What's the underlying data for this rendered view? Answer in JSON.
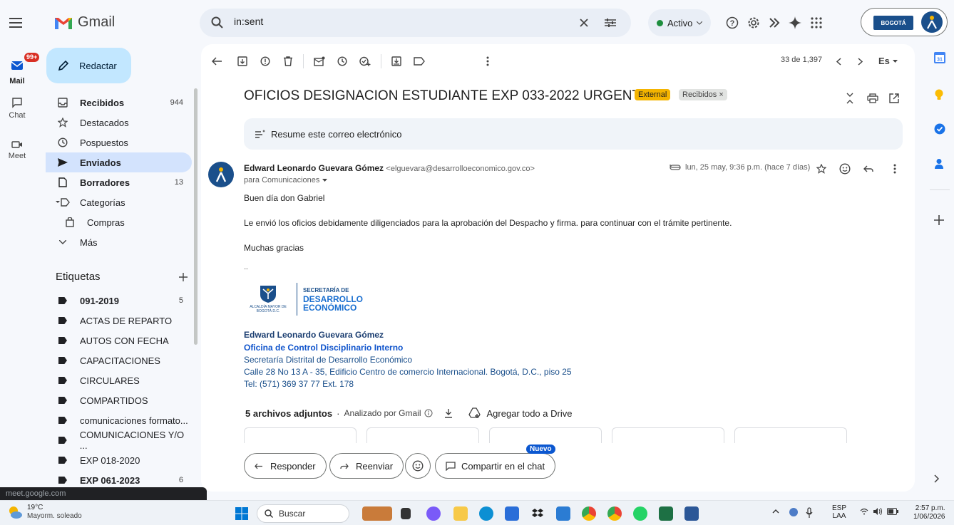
{
  "app": {
    "name": "Gmail"
  },
  "rail": {
    "mail_label": "Mail",
    "mail_badge": "99+",
    "chat_label": "Chat",
    "meet_label": "Meet"
  },
  "search": {
    "value": "in:sent"
  },
  "status": {
    "label": "Activo"
  },
  "account": {
    "org_logo_text": "BOGOTÁ"
  },
  "sidebar": {
    "compose_label": "Redactar",
    "items": [
      {
        "label": "Recibidos",
        "count": "944",
        "icon": "inbox-icon"
      },
      {
        "label": "Destacados",
        "count": "",
        "icon": "star-icon"
      },
      {
        "label": "Pospuestos",
        "count": "",
        "icon": "clock-icon"
      },
      {
        "label": "Enviados",
        "count": "",
        "icon": "send-icon"
      },
      {
        "label": "Borradores",
        "count": "13",
        "icon": "draft-icon"
      },
      {
        "label": "Categorías",
        "count": "",
        "icon": "label-icon"
      },
      {
        "label": "Compras",
        "count": "",
        "icon": "shopping-icon"
      },
      {
        "label": "Más",
        "count": "",
        "icon": "chevron-down-icon"
      }
    ],
    "labels_title": "Etiquetas",
    "labels": [
      {
        "label": "091-2019",
        "count": "5"
      },
      {
        "label": "ACTAS DE REPARTO",
        "count": ""
      },
      {
        "label": "AUTOS CON FECHA",
        "count": ""
      },
      {
        "label": "CAPACITACIONES",
        "count": ""
      },
      {
        "label": "CIRCULARES",
        "count": ""
      },
      {
        "label": "COMPARTIDOS",
        "count": ""
      },
      {
        "label": "comunicaciones formato...",
        "count": ""
      },
      {
        "label": "COMUNICACIONES Y/O ...",
        "count": ""
      },
      {
        "label": "EXP 018-2020",
        "count": ""
      },
      {
        "label": "EXP 061-2023",
        "count": "6"
      }
    ]
  },
  "toolbar": {
    "pagination": "33 de 1,397",
    "lang": "Es"
  },
  "email": {
    "subject": "OFICIOS DESIGNACION ESTUDIANTE EXP 033-2022 URGENTE",
    "tag_external": "External",
    "tag_label": "Recibidos ×",
    "summarize": "Resume este correo electrónico",
    "sender_name": "Edward Leonardo Guevara Gómez",
    "sender_email": "<elguevara@desarrolloeconomico.gov.co>",
    "to": "para Comunicaciones",
    "date": "lun, 25 may, 9:36 p.m. (hace 7 días)",
    "body": [
      "Buen día don Gabriel",
      "Le envió los oficios debidamente diligenciados para la aprobación del Despacho y firma. para continuar con el trámite pertinente.",
      "Muchas gracias"
    ],
    "sig_sep": "--",
    "sig_logo_left": "ALCALDÍA MAYOR DE BOGOTÁ D.C.",
    "sig_logo_right_1": "SECRETARÍA DE",
    "sig_logo_right_2": "DESARROLLO",
    "sig_logo_right_3": "ECONÓMICO",
    "signature": {
      "name": "Edward Leonardo Guevara Gómez",
      "office": "Oficina de Control Disciplinario Interno",
      "entity": "Secretaría Distrital de Desarrollo Económico",
      "address": "Calle 28 No 13 A - 35, Edificio Centro de comercio Internacional. Bogotá, D.C., piso 25",
      "phone": "Tel: (571) 369 37 77 Ext. 178"
    },
    "attachments_title": "5 archivos adjuntos",
    "attachments_scan": "Analizado por Gmail",
    "attachments_drive": "Agregar todo a Drive"
  },
  "reply": {
    "reply": "Responder",
    "forward": "Reenviar",
    "share": "Compartir en el chat",
    "new_badge": "Nuevo"
  },
  "tooltip": {
    "text": "meet.google.com"
  },
  "taskbar": {
    "weather_temp": "19°C",
    "weather_desc": "Mayorm. soleado",
    "search": "Buscar",
    "lang_1": "ESP",
    "lang_2": "LAA",
    "time": "2:57 p.m.",
    "date": "1/06/2026"
  }
}
